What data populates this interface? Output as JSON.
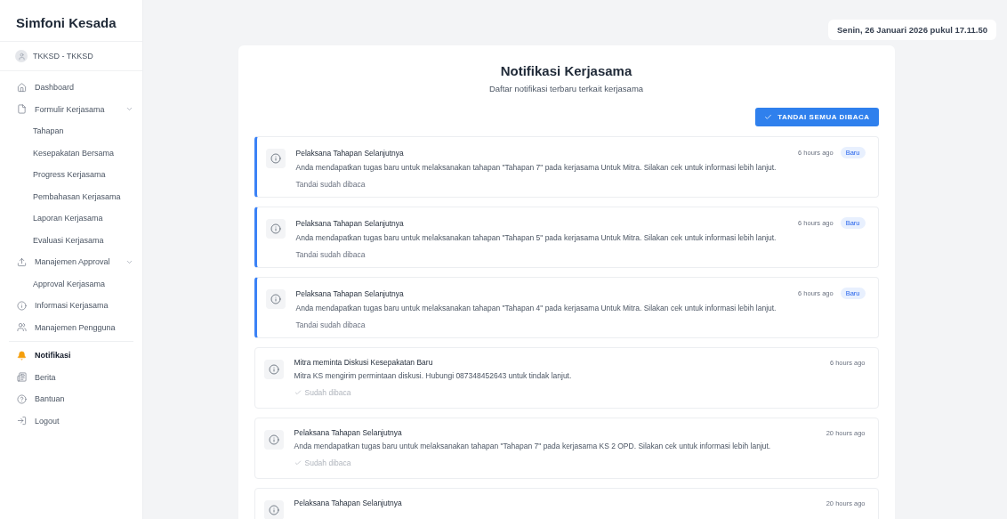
{
  "sidebar": {
    "app_name": "Simfoni Kesada",
    "user": "TKKSD - TKKSD",
    "items": [
      {
        "kind": "item",
        "label": "Dashboard",
        "selected": false
      },
      {
        "kind": "parent",
        "label": "Formulir Kerjasama",
        "expanded": true,
        "selected": false,
        "children": [
          {
            "label": "Tahapan",
            "selected": false
          },
          {
            "label": "Kesepakatan Bersama",
            "selected": false
          },
          {
            "label": "Progress Kerjasama",
            "selected": false
          },
          {
            "label": "Pembahasan Kerjasama",
            "selected": false
          },
          {
            "label": "Laporan Kerjasama",
            "selected": false
          },
          {
            "label": "Evaluasi Kerjasama",
            "selected": false
          }
        ]
      },
      {
        "kind": "parent",
        "label": "Manajemen Approval",
        "expanded": true,
        "selected": false,
        "children": [
          {
            "label": "Approval Kerjasama",
            "selected": false
          }
        ]
      },
      {
        "kind": "item",
        "label": "Informasi Kerjasama",
        "selected": false
      },
      {
        "kind": "item",
        "label": "Manajemen Pengguna",
        "selected": false
      },
      {
        "kind": "divider"
      },
      {
        "kind": "item",
        "label": "Notifikasi",
        "selected": true
      },
      {
        "kind": "item",
        "label": "Berita",
        "selected": false
      },
      {
        "kind": "item",
        "label": "Bantuan",
        "selected": false
      },
      {
        "kind": "item",
        "label": "Logout",
        "selected": false
      }
    ]
  },
  "datetime": "Senin, 26 Januari 2026 pukul 17.11.50",
  "page": {
    "title": "Notifikasi Kerjasama",
    "subtitle": "Daftar notifikasi terbaru terkait kerjasama",
    "mark_all_button": "TANDAI SEMUA DIBACA"
  },
  "notifications": [
    {
      "title": "Pelaksana Tahapan Selanjutnya",
      "time": "6 hours ago",
      "badge": "Baru",
      "unread": true,
      "message": "Anda mendapatkan tugas baru untuk melaksanakan tahapan \"Tahapan 7\" pada kerjasama Untuk Mitra. Silakan cek untuk informasi lebih lanjut.",
      "action": "Tandai sudah dibaca"
    },
    {
      "title": "Pelaksana Tahapan Selanjutnya",
      "time": "6 hours ago",
      "badge": "Baru",
      "unread": true,
      "message": "Anda mendapatkan tugas baru untuk melaksanakan tahapan \"Tahapan 5\" pada kerjasama Untuk Mitra. Silakan cek untuk informasi lebih lanjut.",
      "action": "Tandai sudah dibaca"
    },
    {
      "title": "Pelaksana Tahapan Selanjutnya",
      "time": "6 hours ago",
      "badge": "Baru",
      "unread": true,
      "message": "Anda mendapatkan tugas baru untuk melaksanakan tahapan \"Tahapan 4\" pada kerjasama Untuk Mitra. Silakan cek untuk informasi lebih lanjut.",
      "action": "Tandai sudah dibaca"
    },
    {
      "title": "Mitra meminta Diskusi Kesepakatan Baru",
      "time": "6 hours ago",
      "unread": false,
      "message": "Mitra KS mengirim permintaan diskusi. Hubungi 087348452643 untuk tindak lanjut.",
      "status": "Sudah dibaca"
    },
    {
      "title": "Pelaksana Tahapan Selanjutnya",
      "time": "20 hours ago",
      "unread": false,
      "message": "Anda mendapatkan tugas baru untuk melaksanakan tahapan \"Tahapan 7\" pada kerjasama KS 2 OPD. Silakan cek untuk informasi lebih lanjut.",
      "status": "Sudah dibaca"
    },
    {
      "title": "Pelaksana Tahapan Selanjutnya",
      "time": "20 hours ago",
      "unread": false
    }
  ]
}
